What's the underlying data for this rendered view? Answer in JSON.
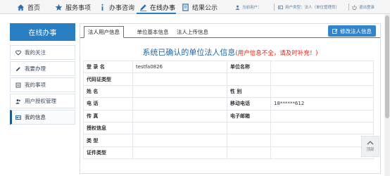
{
  "nav": {
    "items": [
      {
        "label": "首页",
        "icon": "home-icon"
      },
      {
        "label": "服务事项",
        "icon": "star-icon"
      },
      {
        "label": "办事咨询",
        "icon": "info-icon"
      },
      {
        "label": "在线办事",
        "icon": "pencil-icon"
      },
      {
        "label": "结果公示",
        "icon": "document-icon"
      }
    ],
    "active_index": 3,
    "current_user": "当前用户：",
    "user_type": "用户类型：法人（单位管理员）",
    "logout": "退出登录"
  },
  "sidebar": {
    "title": "在线办事",
    "items": [
      {
        "label": "我的关注",
        "icon": "heart-icon"
      },
      {
        "label": "我要办理",
        "icon": "edit-icon"
      },
      {
        "label": "我的事项",
        "icon": "folder-icon"
      },
      {
        "label": "用户授权管理",
        "icon": "users-icon"
      },
      {
        "label": "我的信息",
        "icon": "id-card-icon"
      }
    ],
    "active_index": 4
  },
  "tabs": [
    {
      "label": "法人用户信息"
    },
    {
      "label": "单位基本信息"
    },
    {
      "label": "法人上传信息"
    }
  ],
  "edit_button": "修改法人信息",
  "info": {
    "title": "系统已确认的单位法人信息",
    "warning": "(用户信息不全，请及时补充！)",
    "rows": [
      {
        "l1": "登 录 名",
        "v1": "testfa0826",
        "l2": "单位名称",
        "v2": ""
      },
      {
        "l1": "代码证类型",
        "v1": "",
        "l2": "",
        "v2": ""
      },
      {
        "l1": "姓 名",
        "v1": "",
        "l2": "性 别",
        "v2": ""
      },
      {
        "l1": "电 话",
        "v1": "",
        "l2": "移动电话",
        "v2": "18******612"
      },
      {
        "l1": "传 真",
        "v1": "",
        "l2": "电子邮箱",
        "v2": ""
      },
      {
        "l1": "授权信息",
        "v1": "",
        "l2": "",
        "v2": ""
      },
      {
        "l1": "类 型",
        "v1": "",
        "l2": "",
        "v2": ""
      },
      {
        "l1": "证件类型",
        "v1": "",
        "l2": "",
        "v2": ""
      }
    ]
  },
  "back_top": "顶部",
  "colors": {
    "accent": "#2a7ec2",
    "warning": "#e2231a",
    "title_blue": "#2167a8"
  }
}
